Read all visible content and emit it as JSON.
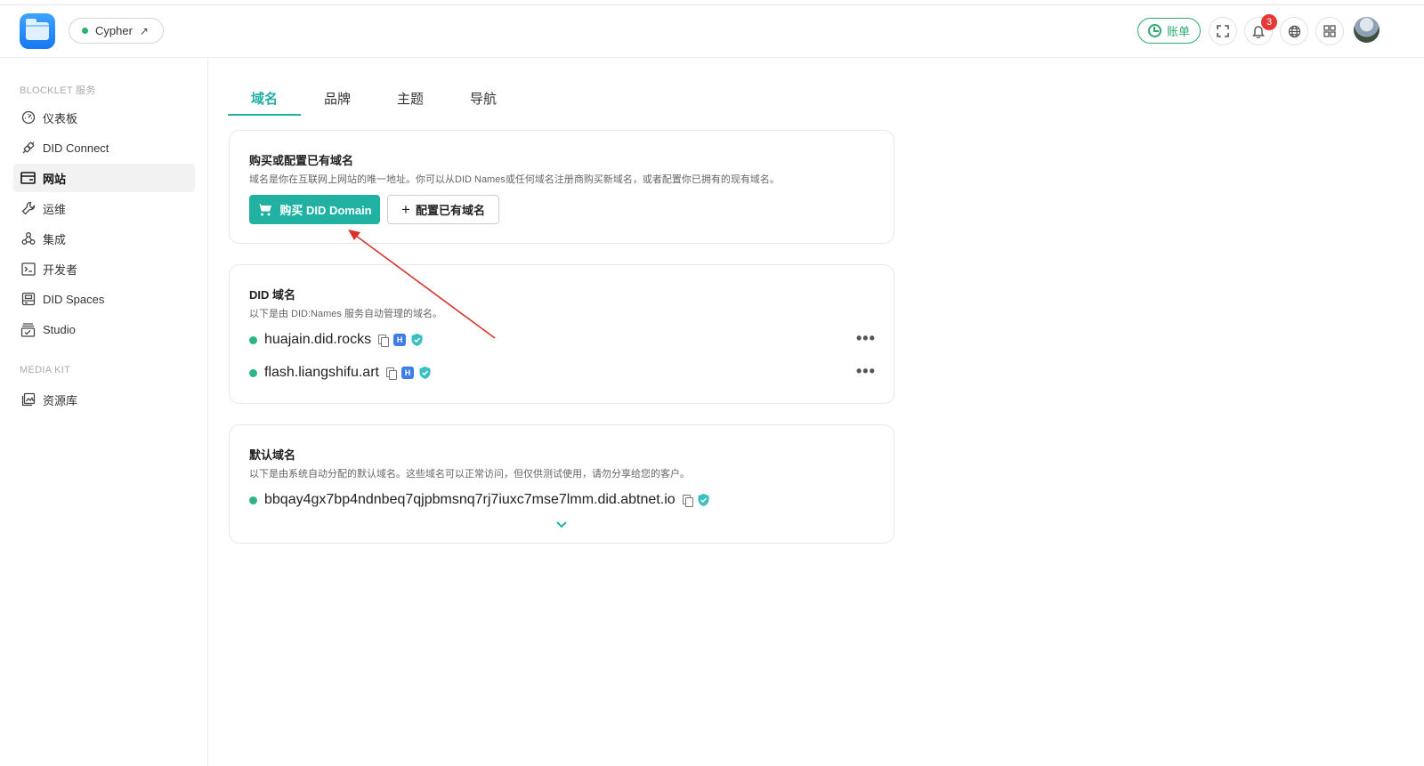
{
  "header": {
    "app_name": "Cypher",
    "app_link_icon": "external-arrow-icon",
    "bill_label": "账单",
    "notification_count": "3",
    "icons": [
      "fullscreen-icon",
      "bell-icon",
      "globe-icon",
      "apps-icon"
    ]
  },
  "sidebar": {
    "section1_title": "BLOCKLET 服务",
    "section2_title": "MEDIA KIT",
    "items": [
      {
        "label": "仪表板",
        "icon": "dashboard-icon"
      },
      {
        "label": "DID Connect",
        "icon": "connect-icon"
      },
      {
        "label": "网站",
        "icon": "website-icon",
        "active": true
      },
      {
        "label": "运维",
        "icon": "wrench-icon"
      },
      {
        "label": "集成",
        "icon": "webhook-icon"
      },
      {
        "label": "开发者",
        "icon": "terminal-icon"
      },
      {
        "label": "DID Spaces",
        "icon": "storage-icon"
      },
      {
        "label": "Studio",
        "icon": "studio-icon"
      }
    ],
    "media_items": [
      {
        "label": "资源库",
        "icon": "library-icon"
      }
    ]
  },
  "tabs": [
    {
      "label": "域名",
      "active": true
    },
    {
      "label": "品牌"
    },
    {
      "label": "主题"
    },
    {
      "label": "导航"
    }
  ],
  "purchase_card": {
    "title": "购买或配置已有域名",
    "desc": "域名是你在互联网上网站的唯一地址。你可以从DID Names或任何域名注册商购买新域名，或者配置你已拥有的现有域名。",
    "buy_label": "购买 DID Domain",
    "config_label": "配置已有域名"
  },
  "did_card": {
    "title": "DID 域名",
    "desc": "以下是由 DID:Names 服务自动管理的域名。",
    "domains": [
      "huajain.did.rocks",
      "flash.liangshifu.art"
    ]
  },
  "default_card": {
    "title": "默认域名",
    "desc": "以下是由系统自动分配的默认域名。这些域名可以正常访问，但仅供测试使用，请勿分享给您的客户。",
    "domain": "bbqay4gx7bp4ndnbeq7qjpbmsnq7rj7iuxc7mse7lmm.did.abtnet.io"
  },
  "colors": {
    "accent": "#21b1a3",
    "status_green": "#2ab58a",
    "bill_green": "#2eaa6e",
    "annotation_arrow": "#d9322a"
  }
}
